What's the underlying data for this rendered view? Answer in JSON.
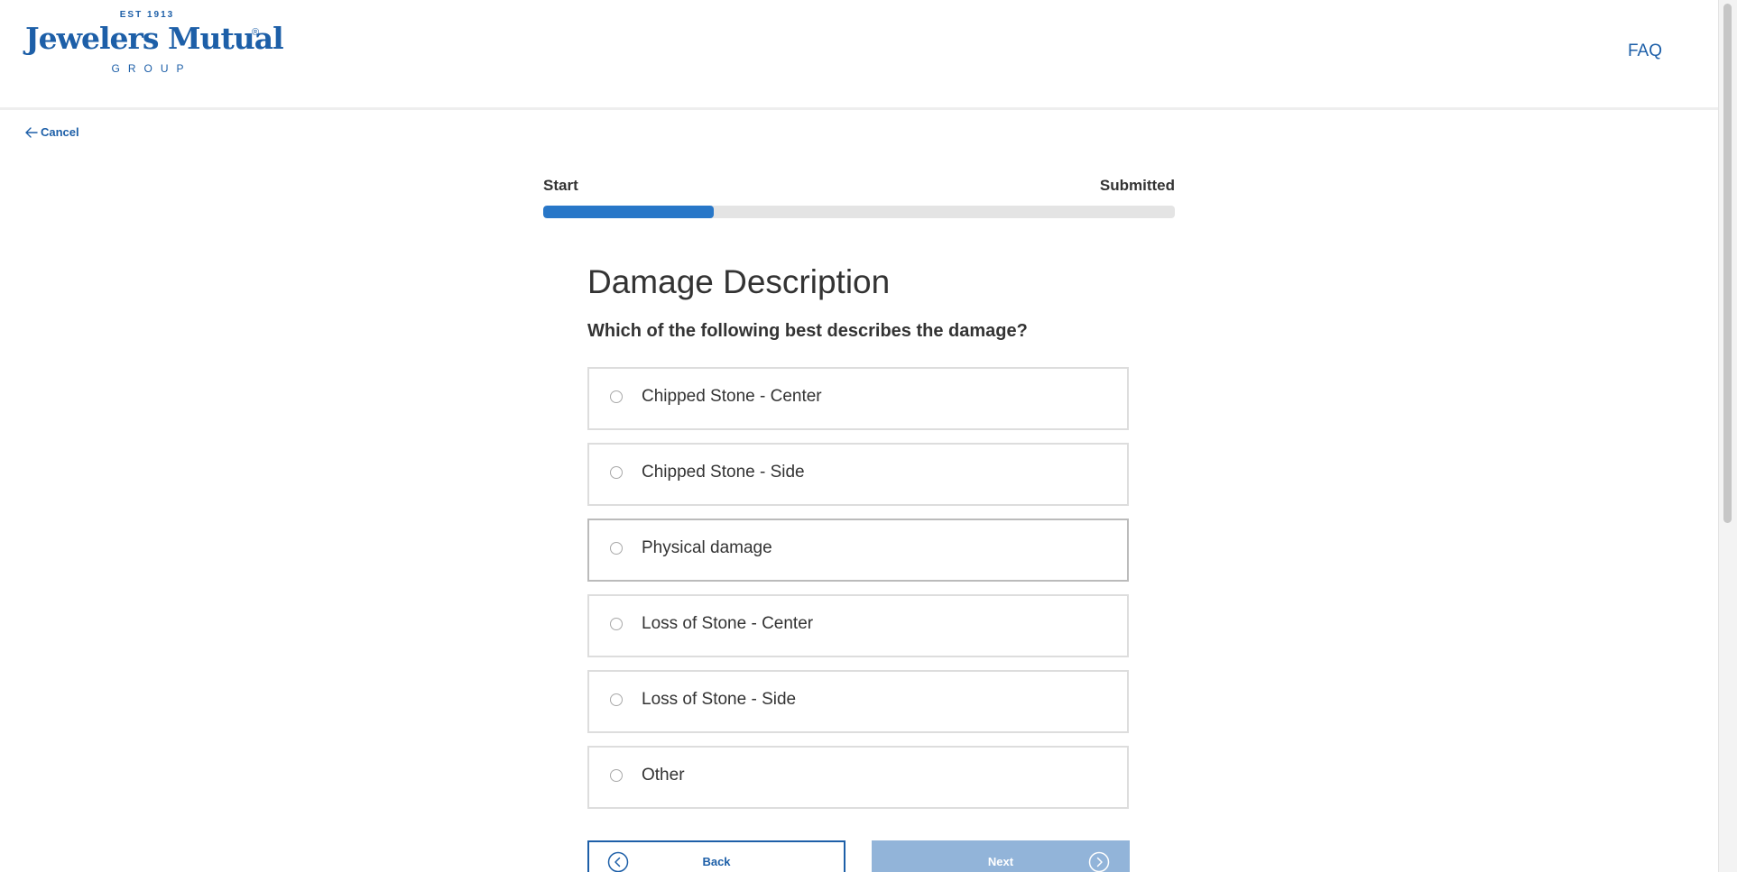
{
  "header": {
    "logo": {
      "est": "EST 1913",
      "name": "Jewelers Mutual",
      "registered": "®",
      "group": "GROUP"
    },
    "faq_label": "FAQ"
  },
  "nav": {
    "cancel_label": "Cancel"
  },
  "progress": {
    "start_label": "Start",
    "end_label": "Submitted",
    "fraction": 0.27,
    "fill_color": "#2877c8"
  },
  "form": {
    "title": "Damage Description",
    "question": "Which of the following best describes the damage?",
    "options": [
      {
        "label": "Chipped Stone - Center",
        "selected": false
      },
      {
        "label": "Chipped Stone - Side",
        "selected": false
      },
      {
        "label": "Physical damage",
        "selected": false
      },
      {
        "label": "Loss of Stone - Center",
        "selected": false
      },
      {
        "label": "Loss of Stone - Side",
        "selected": false
      },
      {
        "label": "Other",
        "selected": false
      }
    ]
  },
  "buttons": {
    "back_label": "Back",
    "next_label": "Next",
    "next_enabled": false
  },
  "colors": {
    "brand": "#1d5fa8",
    "next_disabled": "#92b4d9"
  },
  "icons": {
    "cancel": "arrow-left-icon",
    "back": "chevron-left-circle-icon",
    "next": "chevron-right-circle-icon",
    "option": "radio-icon"
  }
}
